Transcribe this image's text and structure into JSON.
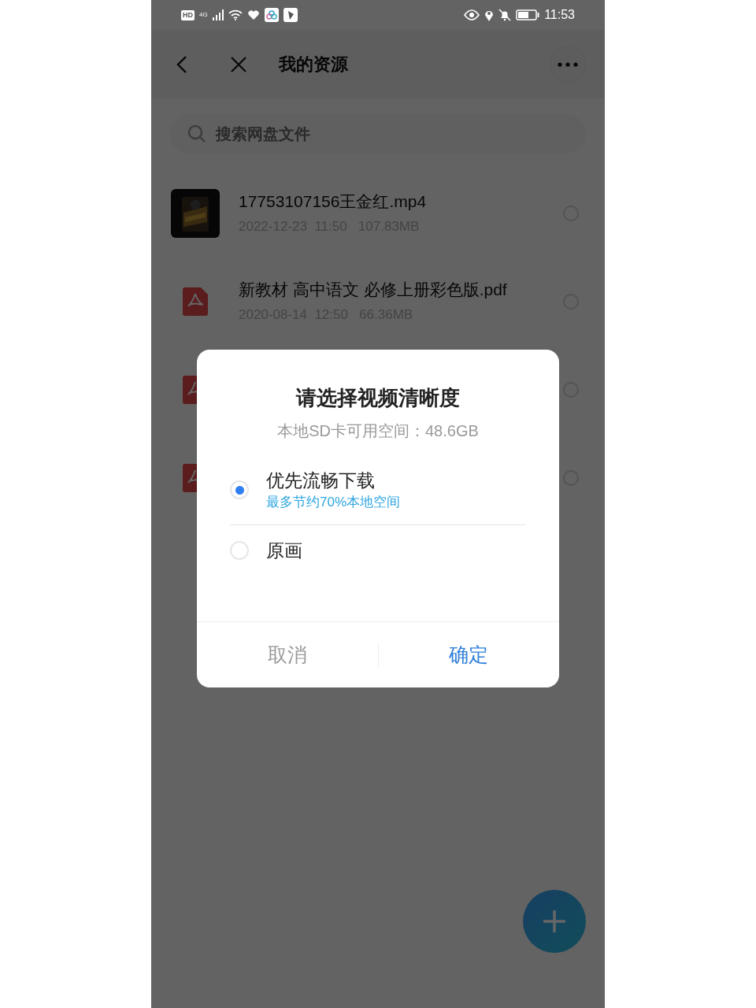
{
  "status_bar": {
    "badge": "HD",
    "network": "4G",
    "time": "11:53"
  },
  "header": {
    "title": "我的资源"
  },
  "search": {
    "placeholder": "搜索网盘文件"
  },
  "files": [
    {
      "kind": "video",
      "name": "17753107156王金红.mp4",
      "meta": "2022-12-23  11:50   107.83MB",
      "selected": false
    },
    {
      "kind": "pdf",
      "name": "新教材 高中语文 必修上册彩色版.pdf",
      "meta": "2020-08-14  12:50   66.36MB",
      "selected": false
    },
    {
      "kind": "pdf",
      "selected": false
    },
    {
      "kind": "pdf",
      "selected": false
    }
  ],
  "dialog": {
    "title": "请选择视频清晰度",
    "storage_note": "本地SD卡可用空间：48.6GB",
    "options": [
      {
        "label": "优先流畅下载",
        "hint": "最多节约70%本地空间",
        "selected": true
      },
      {
        "label": "原画",
        "selected": false
      }
    ],
    "buttons": [
      {
        "label": "取消",
        "kind": "cancel"
      },
      {
        "label": "确定",
        "kind": "confirm"
      }
    ]
  }
}
